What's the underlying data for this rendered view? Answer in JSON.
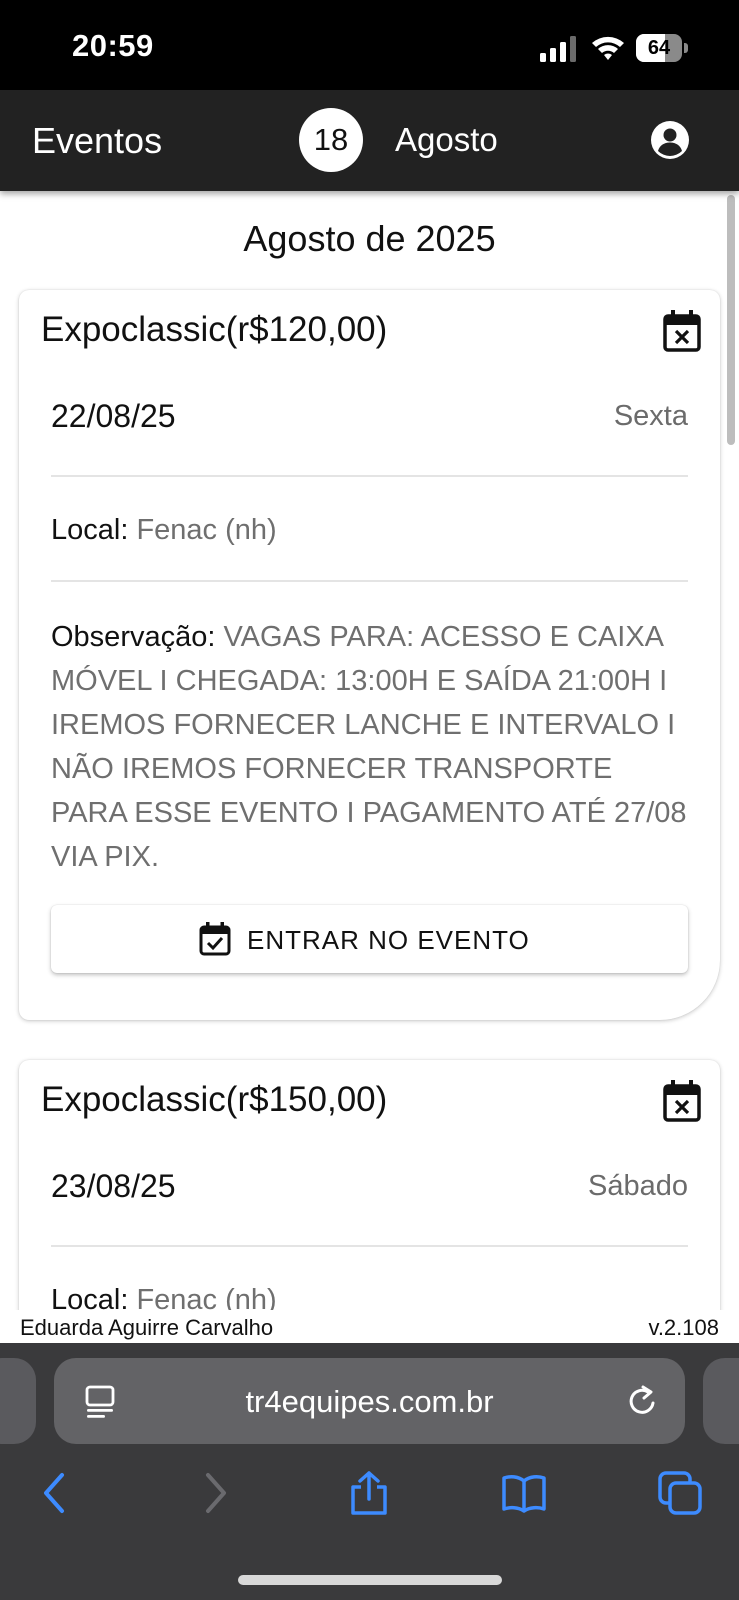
{
  "status_bar": {
    "time": "20:59",
    "battery": "64",
    "battery_level": 0.64
  },
  "app_bar": {
    "title": "Eventos",
    "day": "18",
    "month": "Agosto"
  },
  "page_heading": "Agosto de 2025",
  "events": [
    {
      "title": "Expoclassic(r$120,00)",
      "date": "22/08/25",
      "weekday": "Sexta",
      "local_label": "Local:",
      "local_value": "Fenac (nh)",
      "obs_label": "Observação:",
      "obs_value": "VAGAS PARA: ACESSO E CAIXA MÓVEL I CHEGADA: 13:00H E SAÍDA 21:00H I IREMOS FORNECER LANCHE E INTERVALO I NÃO IREMOS FORNECER TRANSPORTE PARA ESSE EVENTO I PAGAMENTO ATÉ 27/08 VIA PIX.",
      "button_label": "ENTRAR NO EVENTO"
    },
    {
      "title": "Expoclassic(r$150,00)",
      "date": "23/08/25",
      "weekday": "Sábado",
      "local_label": "Local:",
      "local_value": "Fenac (nh)"
    }
  ],
  "footer": {
    "user": "Eduarda Aguirre Carvalho",
    "version": "v.2.108"
  },
  "browser": {
    "url": "tr4equipes.com.br"
  },
  "icons": {
    "calendar_remove": "calendar-remove-icon",
    "calendar_check": "calendar-check-icon",
    "account": "account-circle-icon"
  },
  "colors": {
    "app_bar": "#222222",
    "browser_accent": "#3d8bff",
    "muted_text": "#6f6f6f"
  }
}
